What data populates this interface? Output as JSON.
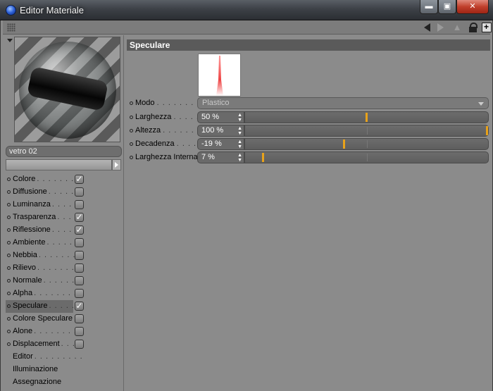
{
  "window": {
    "title": "Editor Materiale",
    "controls": {
      "minimize": "▬",
      "maximize": "▣",
      "close": "✕"
    }
  },
  "toolbar": {
    "icons": [
      "grip-icon",
      "nav-back-icon",
      "nav-forward-icon",
      "up-icon",
      "lock-icon",
      "new-window-icon"
    ]
  },
  "material": {
    "name": "vetro 02"
  },
  "channels": [
    {
      "label": "Colore",
      "dots": ". . . . . . . .",
      "checked": true,
      "has_bullet": true
    },
    {
      "label": "Diffusione",
      "dots": ". . . . . .",
      "checked": false,
      "has_bullet": true
    },
    {
      "label": "Luminanza",
      "dots": ". . . . .",
      "checked": false,
      "has_bullet": true
    },
    {
      "label": "Trasparenza",
      "dots": ". . . .",
      "checked": true,
      "has_bullet": true
    },
    {
      "label": "Riflessione",
      "dots": ". . . . .",
      "checked": true,
      "has_bullet": true
    },
    {
      "label": "Ambiente",
      "dots": ". . . . . .",
      "checked": false,
      "has_bullet": true
    },
    {
      "label": "Nebbia",
      "dots": ". . . . . . . .",
      "checked": false,
      "has_bullet": true
    },
    {
      "label": "Rilievo",
      "dots": ". . . . . . . .",
      "checked": false,
      "has_bullet": true
    },
    {
      "label": "Normale",
      "dots": ". . . . . . .",
      "checked": false,
      "has_bullet": true
    },
    {
      "label": "Alpha",
      "dots": ". . . . . . . . .",
      "checked": false,
      "has_bullet": true
    },
    {
      "label": "Speculare",
      "dots": ". . . . . .",
      "checked": true,
      "has_bullet": true,
      "active": true
    },
    {
      "label": "Colore Speculare",
      "dots": "",
      "checked": false,
      "has_bullet": true
    },
    {
      "label": "Alone",
      "dots": ". . . . . . . . .",
      "checked": false,
      "has_bullet": true
    },
    {
      "label": "Displacement",
      "dots": ". . .",
      "checked": false,
      "has_bullet": true
    },
    {
      "label": "Editor",
      "dots": ". . . . . . . . .",
      "checked": null,
      "has_bullet": false
    },
    {
      "label": "Illuminazione",
      "dots": "",
      "checked": null,
      "has_bullet": false
    },
    {
      "label": "Assegnazione",
      "dots": "",
      "checked": null,
      "has_bullet": false
    }
  ],
  "specular": {
    "section_title": "Speculare",
    "mode": {
      "label": "Modo",
      "dots": ". . . . . . . . .",
      "value": "Plastico"
    },
    "params": [
      {
        "label": "Larghezza",
        "dots": ". . . . .",
        "display": "50 %",
        "fraction": 0.5
      },
      {
        "label": "Altezza",
        "dots": ". . . . . . . .",
        "display": "100 %",
        "fraction": 1.0
      },
      {
        "label": "Decadenza",
        "dots": ". . . .",
        "display": "-19 %",
        "fraction": 0.405
      },
      {
        "label": "Larghezza Interna",
        "dots": "",
        "display": "7 %",
        "fraction": 0.07
      }
    ]
  },
  "colors": {
    "accent_handle": "#e8a21a",
    "panel_bg": "#8b8b8b",
    "header_bg": "#5a5a5a"
  }
}
